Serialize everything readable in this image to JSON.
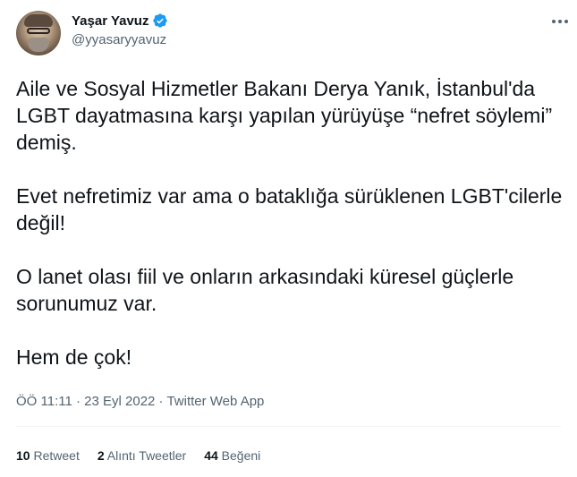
{
  "author": {
    "display_name": "Yaşar Yavuz",
    "handle": "@yyasaryyavuz",
    "verified_icon": "verified-badge-icon",
    "verified_color": "#1d9bf0"
  },
  "tweet": {
    "paragraphs": [
      "Aile ve Sosyal Hizmetler Bakanı Derya Yanık, İstanbul'da LGBT dayatmasına karşı yapılan yürüyüşe “nefret söylemi” demiş.",
      "Evet nefretimiz var ama o bataklığa sürüklenen LGBT'cilerle değil!",
      "O lanet olası fiil ve onların arkasındaki küresel güçlerle sorunumuz var.",
      "Hem de çok!"
    ],
    "time": "ÖÖ 11:11",
    "separator": " · ",
    "date": "23 Eyl 2022",
    "source": "Twitter Web App"
  },
  "stats": {
    "retweets_count": "10",
    "retweets_label": "Retweet",
    "quotes_count": "2",
    "quotes_label": "Alıntı Tweetler",
    "likes_count": "44",
    "likes_label": "Beğeni"
  },
  "more_icon": "more-options-icon"
}
